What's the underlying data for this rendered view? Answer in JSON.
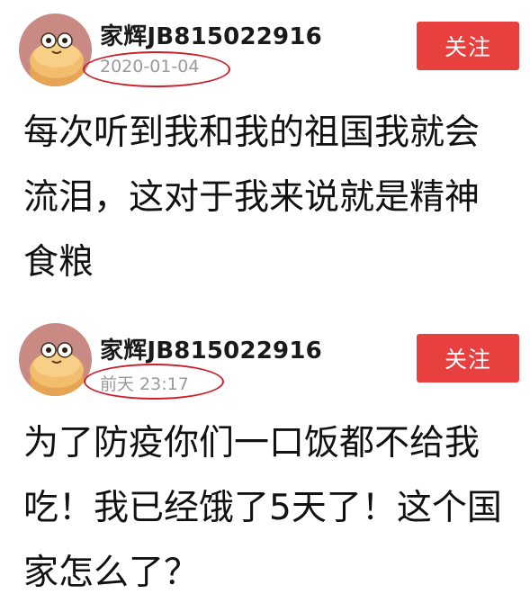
{
  "posts": [
    {
      "username": "家辉JB815022916",
      "timestamp": "2020-01-04",
      "follow_label": "关注",
      "content": "每次听到我和我的祖国我就会流泪，这对于我来说就是精神食粮"
    },
    {
      "username": "家辉JB815022916",
      "timestamp": "前天 23:17",
      "follow_label": "关注",
      "content": "为了防疫你们一口饭都不给我吃！我已经饿了5天了！这个国家怎么了？"
    }
  ],
  "colors": {
    "follow_button": "#e8403f",
    "highlight_oval": "#cc1f2a",
    "timestamp": "#9a9a9a",
    "avatar_background": "#c98a84"
  },
  "icons": {
    "avatar": "cartoon-bun-character-icon"
  }
}
